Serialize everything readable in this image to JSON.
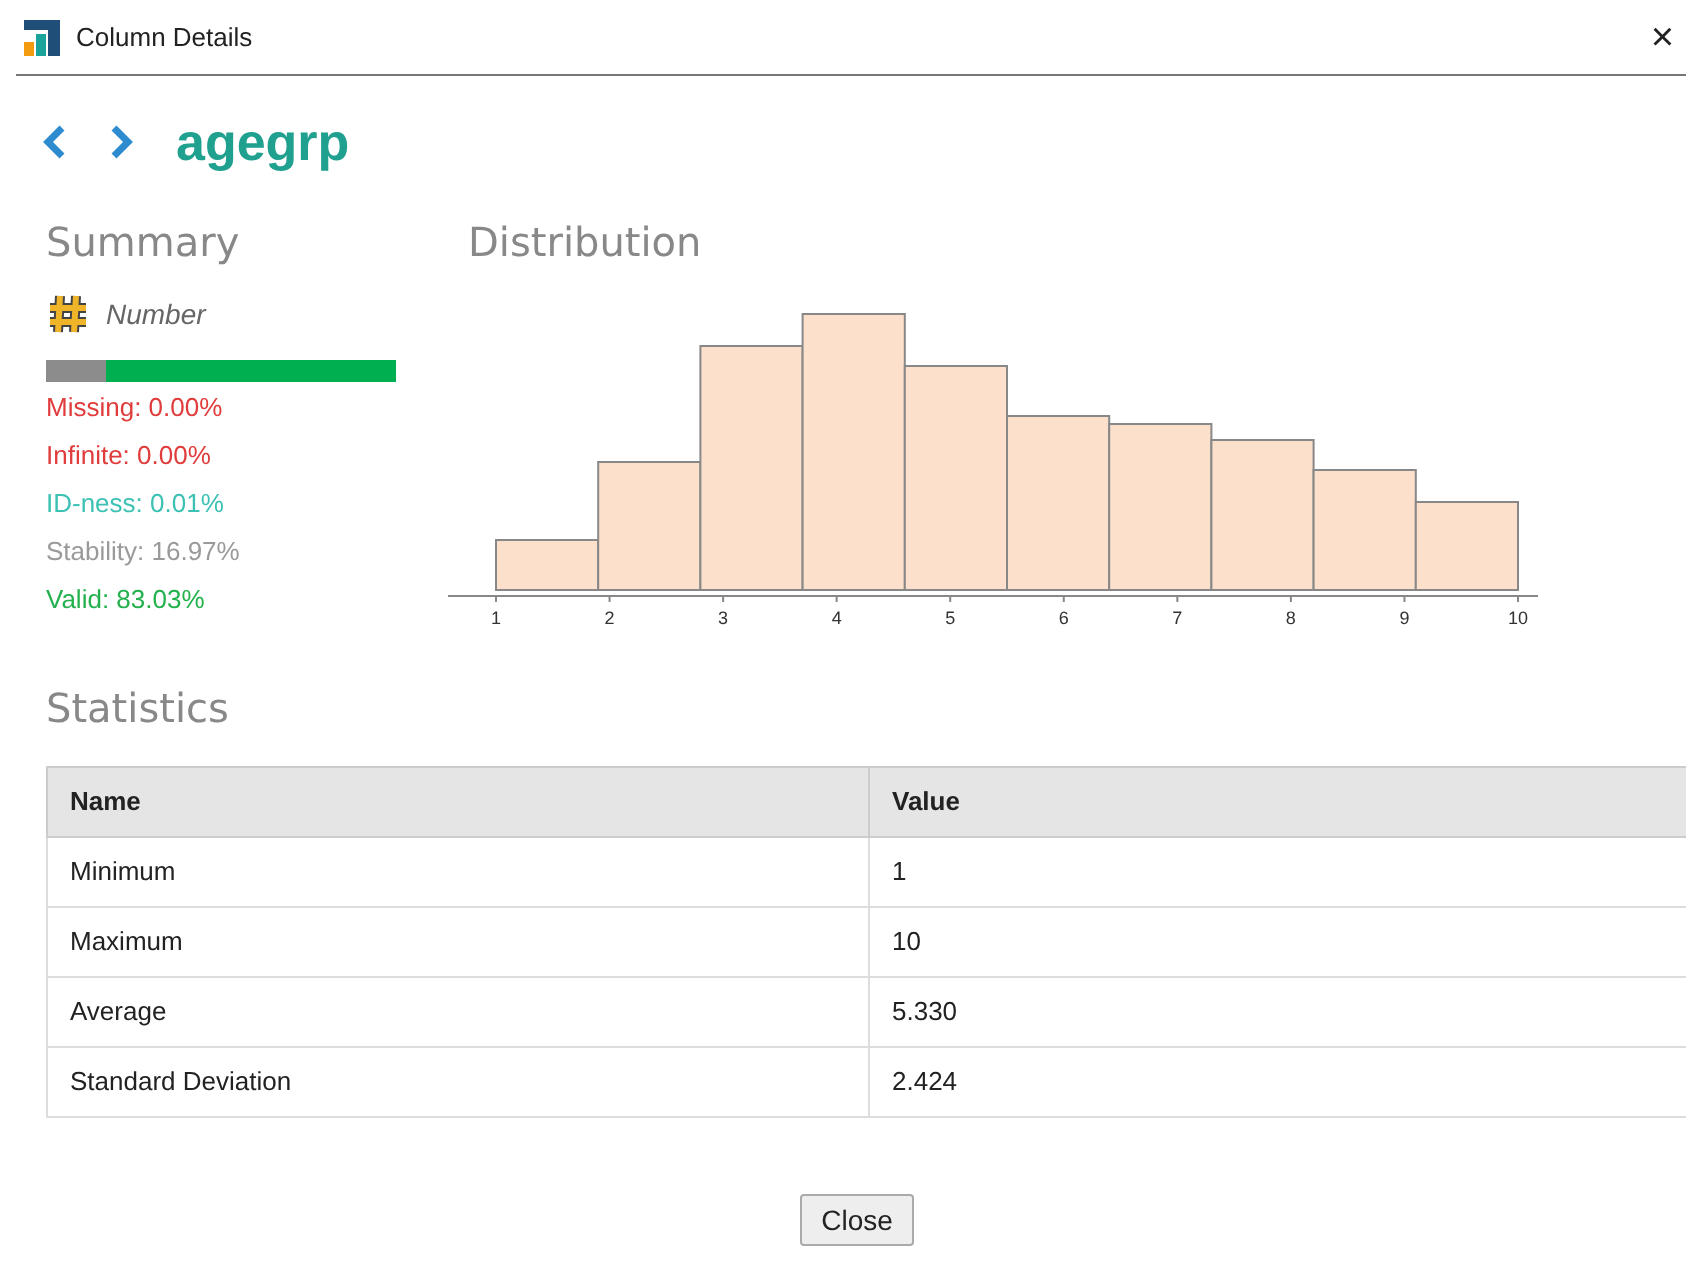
{
  "window": {
    "title": "Column Details",
    "close": "×"
  },
  "header": {
    "column_name": "agegrp"
  },
  "summary": {
    "title": "Summary",
    "type": "Number",
    "bar": {
      "level": 0.17
    },
    "stats": [
      {
        "text": "Missing: 0.00%",
        "color": "#e03c3c"
      },
      {
        "text": "Infinite: 0.00%",
        "color": "#e03c3c"
      },
      {
        "text": "ID-ness: 0.01%",
        "color": "#3cc1b4"
      },
      {
        "text": "Stability: 16.97%",
        "color": "#9a9a9a"
      },
      {
        "text": "Valid: 83.03%",
        "color": "#22b14c"
      }
    ]
  },
  "distribution": {
    "title": "Distribution",
    "tick_labels": [
      "1",
      "2",
      "3",
      "4",
      "5",
      "6",
      "7",
      "8",
      "9",
      "10"
    ]
  },
  "statistics": {
    "title": "Statistics",
    "columns": [
      "Name",
      "Value"
    ],
    "rows": [
      [
        "Minimum",
        "1"
      ],
      [
        "Maximum",
        "10"
      ],
      [
        "Average",
        "5.330"
      ],
      [
        "Standard Deviation",
        "2.424"
      ]
    ]
  },
  "buttons": [
    "Close"
  ]
}
